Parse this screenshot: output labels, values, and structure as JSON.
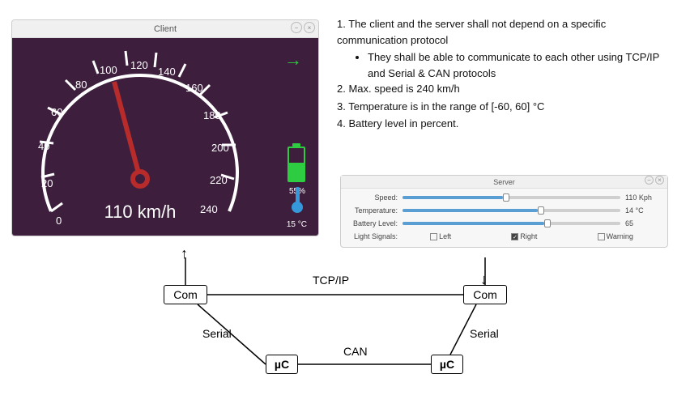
{
  "client": {
    "title": "Client",
    "speed_value": 110,
    "speed_display": "110 km/h",
    "battery_pct": 55,
    "battery_display": "55%",
    "temp_display": "15 °C",
    "gauge_ticks": [
      "0",
      "20",
      "40",
      "60",
      "80",
      "100",
      "120",
      "140",
      "160",
      "180",
      "200",
      "220",
      "240"
    ]
  },
  "requirements": {
    "line1": "1. The client and the server shall not depend on a specific communication protocol",
    "bullet1": "They shall be able to communicate to each other using TCP/IP and Serial & CAN protocols",
    "line2": "2. Max. speed is 240 km/h",
    "line3": "3. Temperature is in the range of [-60, 60] °C",
    "line4": "4. Battery level in percent."
  },
  "server": {
    "title": "Server",
    "rows": {
      "speed": {
        "label": "Speed:",
        "value": 110,
        "display": "110 Kph",
        "min": 0,
        "max": 240
      },
      "temp": {
        "label": "Temperature:",
        "value": 14,
        "display": "14 °C",
        "min": -60,
        "max": 60
      },
      "batt": {
        "label": "Battery Level:",
        "value": 65,
        "display": "65",
        "min": 0,
        "max": 100
      }
    },
    "signals_label": "Light Signals:",
    "signals": {
      "left": {
        "label": "Left",
        "checked": false
      },
      "right": {
        "label": "Right",
        "checked": true
      },
      "warning": {
        "label": "Warning",
        "checked": false
      }
    }
  },
  "diagram": {
    "com": "Com",
    "uc": "µC",
    "serial": "Serial",
    "tcpip": "TCP/IP",
    "can": "CAN"
  }
}
